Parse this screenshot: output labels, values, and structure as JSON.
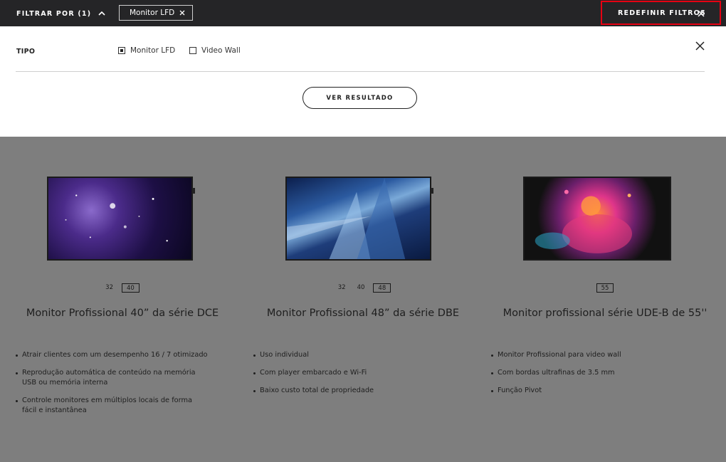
{
  "topbar": {
    "filter_label": "FILTRAR POR (1)",
    "chip_label": "Monitor LFD",
    "reset_label": "REDEFINIR FILTROS",
    "reset_highlight_color": "#e60012"
  },
  "panel": {
    "tipo_label": "TIPO",
    "options": [
      {
        "label": "Monitor LFD",
        "checked": true
      },
      {
        "label": "Video Wall",
        "checked": false
      }
    ],
    "results_button": "VER RESULTADO"
  },
  "products": [
    {
      "sizes": [
        "32",
        "40"
      ],
      "active_size": "40",
      "title": "Monitor Profissional 40” da série DCE",
      "features": [
        "Atrair clientes com um desempenho 16 / 7 otimizado",
        "Reprodução automática de conteúdo na memória USB ou memória interna",
        "Controle monitores em múltiplos locais de forma fácil e instantânea"
      ]
    },
    {
      "sizes": [
        "32",
        "40",
        "48"
      ],
      "active_size": "48",
      "title": "Monitor Profissional 48” da série DBE",
      "features": [
        "Uso individual",
        "Com player embarcado e Wi-Fi",
        "Baixo custo total de propriedade"
      ]
    },
    {
      "sizes": [
        "55"
      ],
      "active_size": "55",
      "title": "Monitor profissional série UDE-B de 55''",
      "features": [
        "Monitor Profissional para video wall",
        "Com bordas ultrafinas de 3.5 mm",
        "Função Pivot"
      ]
    }
  ]
}
